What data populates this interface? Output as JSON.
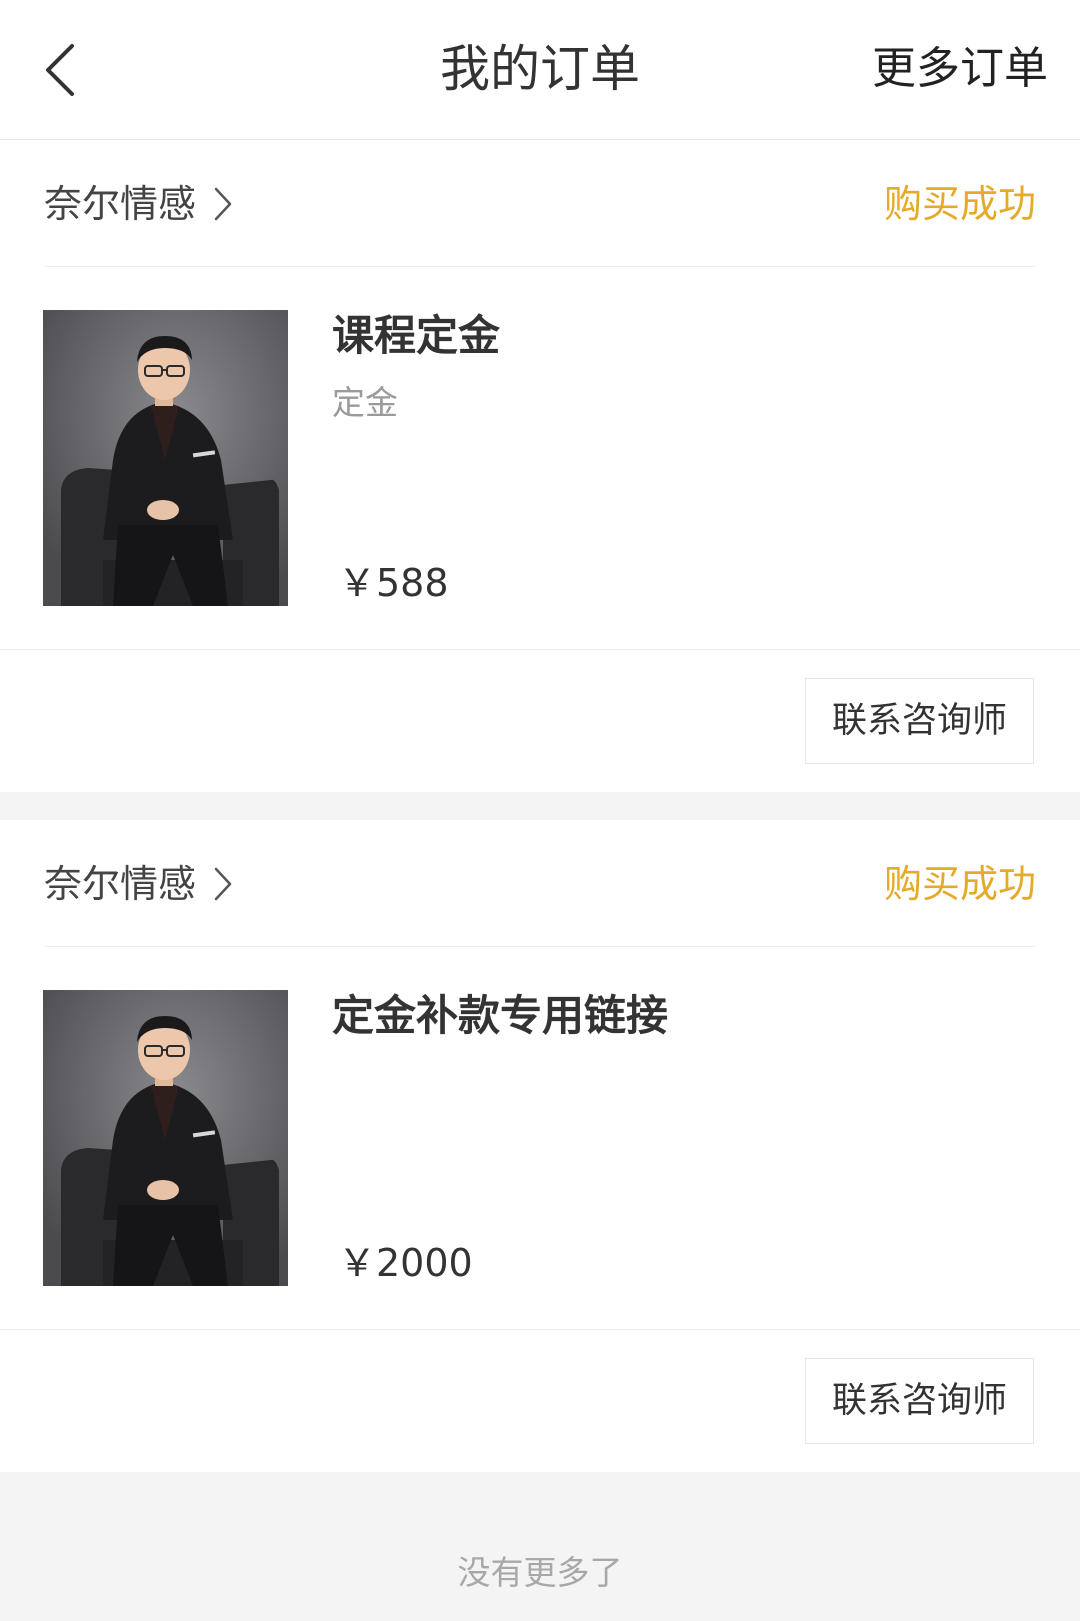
{
  "header": {
    "title": "我的订单",
    "more_label": "更多订单",
    "back_icon": "chevron-left-icon"
  },
  "orders": [
    {
      "shop_name": "奈尔情感",
      "status": "购买成功",
      "status_color": "#e6aa2b",
      "product_title": "课程定金",
      "product_sku": "定金",
      "price": "￥588",
      "action_label": "联系咨询师"
    },
    {
      "shop_name": "奈尔情感",
      "status": "购买成功",
      "status_color": "#e6aa2b",
      "product_title": "定金补款专用链接",
      "product_sku": "",
      "price": "￥2000",
      "action_label": "联系咨询师"
    }
  ],
  "footer": {
    "text": "没有更多了"
  }
}
